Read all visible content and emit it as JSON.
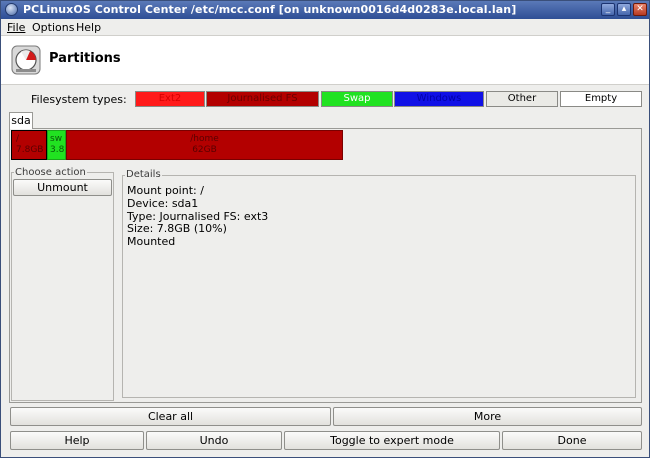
{
  "window": {
    "title": "PCLinuxOS Control Center /etc/mcc.conf [on unknown0016d4d0283e.local.lan]",
    "controls": [
      "minimize-icon",
      "maximize-icon",
      "close-icon"
    ]
  },
  "menu": {
    "file": "File",
    "options": "Options",
    "help": "Help"
  },
  "header": {
    "title": "Partitions",
    "icon": "disk-pie-icon"
  },
  "filesystem_types": {
    "label": "Filesystem types:",
    "items": [
      {
        "label": "Ext2",
        "color": "#ff1a1a"
      },
      {
        "label": "Journalised FS",
        "color": "#b30000"
      },
      {
        "label": "Swap",
        "color": "#21e221"
      },
      {
        "label": "Windows",
        "color": "#1010e6"
      },
      {
        "label": "Other",
        "color": "#eaeae6"
      },
      {
        "label": "Empty",
        "color": "#ffffff"
      }
    ]
  },
  "tabs": [
    {
      "label": "sda"
    }
  ],
  "partitions": [
    {
      "line1": "/",
      "line2": "7.8GB",
      "type": "Journalised FS"
    },
    {
      "line1": "sw",
      "line2": "3.8",
      "type": "Swap"
    },
    {
      "line1": "/home",
      "line2": "62GB",
      "type": "Journalised FS"
    }
  ],
  "action": {
    "legend": "Choose action",
    "unmount": "Unmount"
  },
  "details": {
    "legend": "Details",
    "lines": [
      "Mount point: /",
      "Device: sda1",
      "Type: Journalised FS: ext3",
      "Size: 7.8GB (10%)",
      "Mounted"
    ]
  },
  "buttons": {
    "clear_all": "Clear all",
    "more": "More",
    "help": "Help",
    "undo": "Undo",
    "toggle_expert": "Toggle to expert mode",
    "done": "Done"
  }
}
